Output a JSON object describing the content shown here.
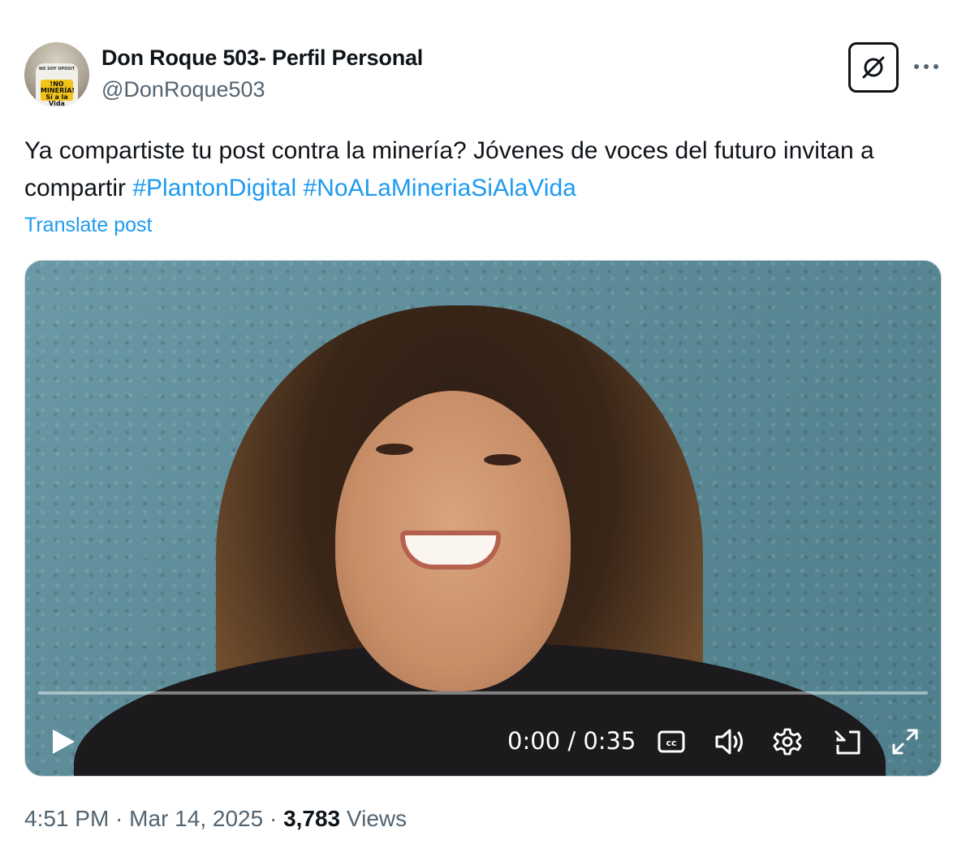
{
  "author": {
    "display_name": "Don Roque 503- Perfil Personal",
    "handle": "@DonRoque503",
    "avatar": {
      "shirt_text": "NO SOY OPOSITOR PERO DE FAMILIA Y SO ECO",
      "badge_text": "!NO MINERÍA! Sí a la Vida"
    }
  },
  "post": {
    "text_part1": "Ya compartiste tu post contra la minería? Jóvenes de voces del futuro invitan a compartir ",
    "hashtag1": "#PlantonDigital",
    "hashtag2": "#NoALaMineriaSiAlaVida",
    "translate_label": "Translate post"
  },
  "video": {
    "progress": 0,
    "time_display": "0:00 / 0:35"
  },
  "meta": {
    "time": "4:51 PM",
    "separator": " · ",
    "date": "Mar 14, 2025",
    "views_count": "3,783",
    "views_label": "Views"
  },
  "icons": {
    "grok": "grok-icon",
    "more": "more-dots-icon",
    "play": "play-icon",
    "cc": "closed-captions-icon",
    "volume": "volume-icon",
    "settings": "gear-icon",
    "dock": "dock-icon",
    "fullscreen": "fullscreen-icon"
  }
}
